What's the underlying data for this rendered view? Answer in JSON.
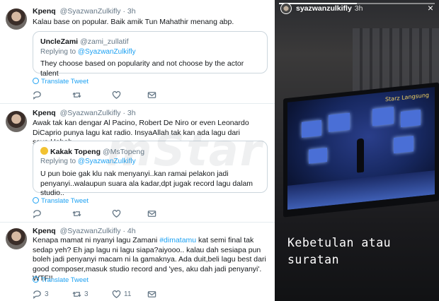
{
  "tweets": [
    {
      "name": "Kpenq",
      "handle": "@SyazwanZulkifly",
      "time": "· 3h",
      "text": "Kalau base on popular. Baik amik Tun Mahathir menang abp.",
      "quote": {
        "name": "UncleZami",
        "handle": "@zami_zullatif",
        "replying_label": "Replying to",
        "replying_to": "@SyazwanZulkifly",
        "text": "They choose based on popularity and not choose by the actor talent"
      },
      "translate": "Translate Tweet",
      "reply_count": "",
      "retweet_count": "",
      "like_count": ""
    },
    {
      "name": "Kpenq",
      "handle": "@SyazwanZulkifly",
      "time": "· 3h",
      "text": "Awak tak kan dengar Al Pacino, Robert De Niro or even Leonardo DiCaprio punya lagu kat radio. InsyaAllah tak kan ada lagu dari saya.Heheh",
      "quote": {
        "name": "Kakak Topeng",
        "handle": "@MsTopeng",
        "replying_label": "Replying to",
        "replying_to": "@SyazwanZulkifly",
        "text": "U pun boie gak klu nak menyanyi..kan ramai pelakon jadi penyanyi..walaupun suara ala kadar,dpt jugak record lagu dalam studio.."
      },
      "translate": "Translate Tweet",
      "reply_count": "",
      "retweet_count": "",
      "like_count": ""
    },
    {
      "name": "Kpenq",
      "handle": "@SyazwanZulkifly",
      "time": "· 4h",
      "text_before": "Kenapa mamat ni nyanyi lagu Zamani ",
      "hashtag": "#dimatamu",
      "text_after": " kat semi final tak sedap yeh? Eh jap lagu ni lagu siapa?aiyooo.. kalau dah sesiapa pun boleh jadi penyanyi macam ni la gamaknya. Ada duit,beli lagu best dari good composer,masuk studio record and 'yes, aku dah jadi penyanyi'. WTF!!",
      "translate": "Translate Tweet",
      "reply_count": "3",
      "retweet_count": "3",
      "like_count": "11"
    }
  ],
  "watermark": "mStar",
  "story": {
    "username": "syazwanzulkifly",
    "time": "3h",
    "close": "×",
    "progress": 0.5,
    "tv_logo": "Starz Langsung",
    "caption_line1": "Kebetulan atau",
    "caption_line2": "suratan"
  }
}
